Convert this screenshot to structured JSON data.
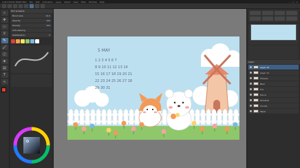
{
  "app": {
    "title": "CLIP STUDIO PAINT PRO",
    "menu": [
      "File",
      "Edit",
      "Animation",
      "Layer",
      "Select",
      "View",
      "Filter",
      "Window",
      "Help"
    ]
  },
  "tool_property": {
    "panel_title": "Tool property",
    "rows": [
      {
        "label": "Brush size",
        "value": "10.0"
      },
      {
        "label": "Opacity",
        "value": "100"
      },
      {
        "label": "Density",
        "value": "100"
      },
      {
        "label": "Anti-aliasing",
        "value": ""
      },
      {
        "label": "Stabilization",
        "value": "5"
      }
    ]
  },
  "calendar": {
    "month_label": "5 MAY",
    "rows": [
      "1  2  3  4  5  6  7",
      "8  9 10 11 12 13 14",
      "15 16 17 18 19 20 21",
      "22 23 24 25 26 27 28",
      "29 30 31"
    ]
  },
  "layers": {
    "panel_title": "Layer",
    "items": [
      {
        "name": "Layer 12"
      },
      {
        "name": "Layer 11"
      },
      {
        "name": "Flowers"
      },
      {
        "name": "Bear"
      },
      {
        "name": "Fox"
      },
      {
        "name": "Fence"
      },
      {
        "name": "Windmill"
      },
      {
        "name": "Clouds"
      },
      {
        "name": "Paper"
      }
    ]
  },
  "colors": {
    "main": "#d9442f",
    "sub": "#ffffff",
    "accent": "#4e6f92",
    "sky": "#bde0f0",
    "grass": "#8ec86a"
  }
}
